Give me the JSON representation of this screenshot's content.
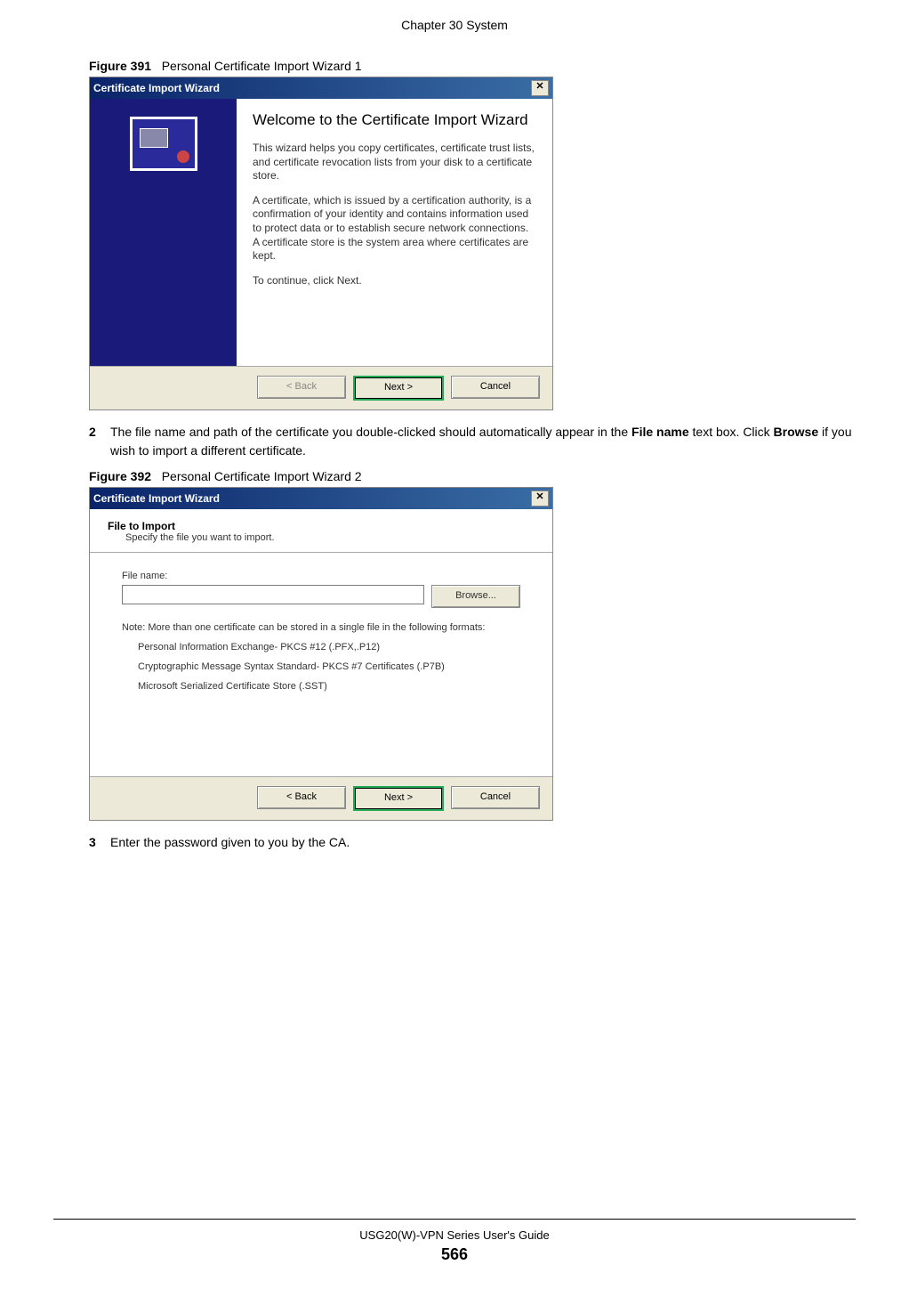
{
  "chapter_header": "Chapter 30 System",
  "figure1": {
    "label": "Figure 391",
    "caption": "Personal Certificate Import Wizard 1"
  },
  "wizard1": {
    "title": "Certificate Import Wizard",
    "heading": "Welcome to the Certificate Import Wizard",
    "para1": "This wizard helps you copy certificates, certificate trust lists, and certificate revocation lists from your disk to a certificate store.",
    "para2": "A certificate, which is issued by a certification authority, is a confirmation of your identity and contains information used to protect data or to establish secure network connections. A certificate store is the system area where certificates are kept.",
    "para3": "To continue, click Next.",
    "back": "< Back",
    "next": "Next >",
    "cancel": "Cancel"
  },
  "step2": {
    "num": "2",
    "text_pre": "The file name and path of the certificate you double-clicked should automatically appear in the ",
    "bold1": "File name",
    "text_mid": " text box. Click ",
    "bold2": "Browse",
    "text_post": " if you wish to import a different certificate."
  },
  "figure2": {
    "label": "Figure 392",
    "caption": "Personal Certificate Import Wizard 2"
  },
  "wizard2": {
    "title": "Certificate Import Wizard",
    "header_main": "File to Import",
    "header_sub": "Specify the file you want to import.",
    "filename_label": "File name:",
    "filename_value": "",
    "browse": "Browse...",
    "note": "Note:  More than one certificate can be stored in a single file in the following formats:",
    "fmt1": "Personal Information Exchange- PKCS #12 (.PFX,.P12)",
    "fmt2": "Cryptographic Message Syntax Standard- PKCS #7 Certificates (.P7B)",
    "fmt3": "Microsoft Serialized Certificate Store (.SST)",
    "back": "< Back",
    "next": "Next >",
    "cancel": "Cancel"
  },
  "step3": {
    "num": "3",
    "text": "Enter the password given to you by the CA."
  },
  "footer": {
    "guide": "USG20(W)-VPN Series User's Guide",
    "page": "566"
  }
}
